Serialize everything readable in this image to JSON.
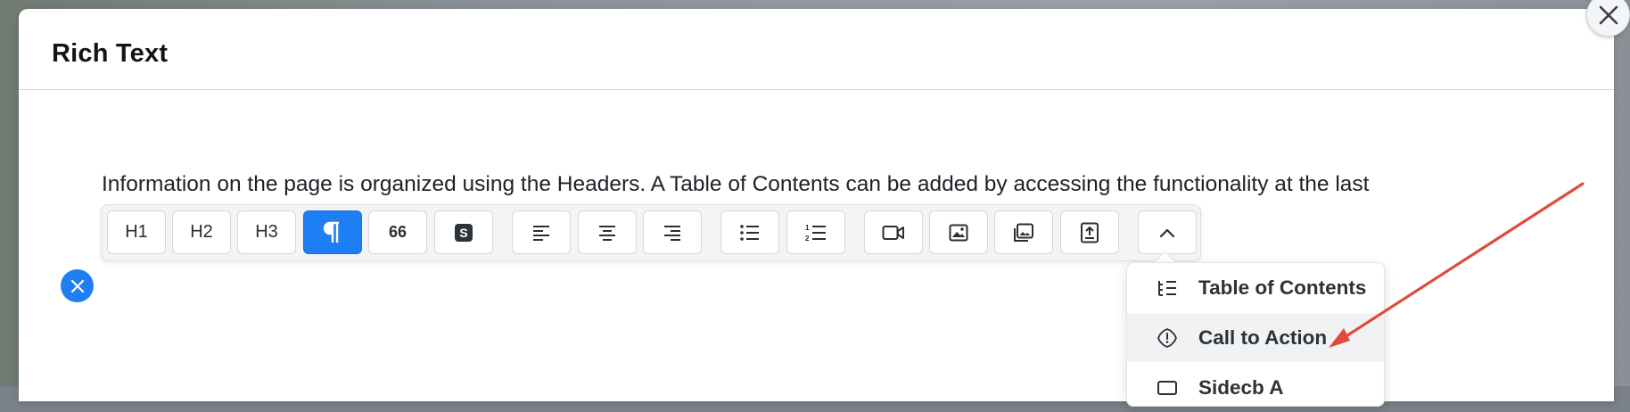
{
  "modal": {
    "title": "Rich Text"
  },
  "editor": {
    "paragraph_text": "Information on the page is organized using the Headers. A Table of Contents can be added by accessing the functionality at the last"
  },
  "toolbar": {
    "h1_label": "H1",
    "h2_label": "H2",
    "h3_label": "H3",
    "quote_label": "66",
    "active_button": "paragraph"
  },
  "dropdown": {
    "items": [
      {
        "label": "Table of Contents",
        "icon": "table-of-contents-icon"
      },
      {
        "label": "Call to Action",
        "icon": "call-to-action-icon"
      },
      {
        "label": "Sidecb A",
        "icon": "block-icon"
      }
    ]
  },
  "colors": {
    "accent": "#1e7ff5",
    "annotation_arrow": "#e04a3a"
  }
}
